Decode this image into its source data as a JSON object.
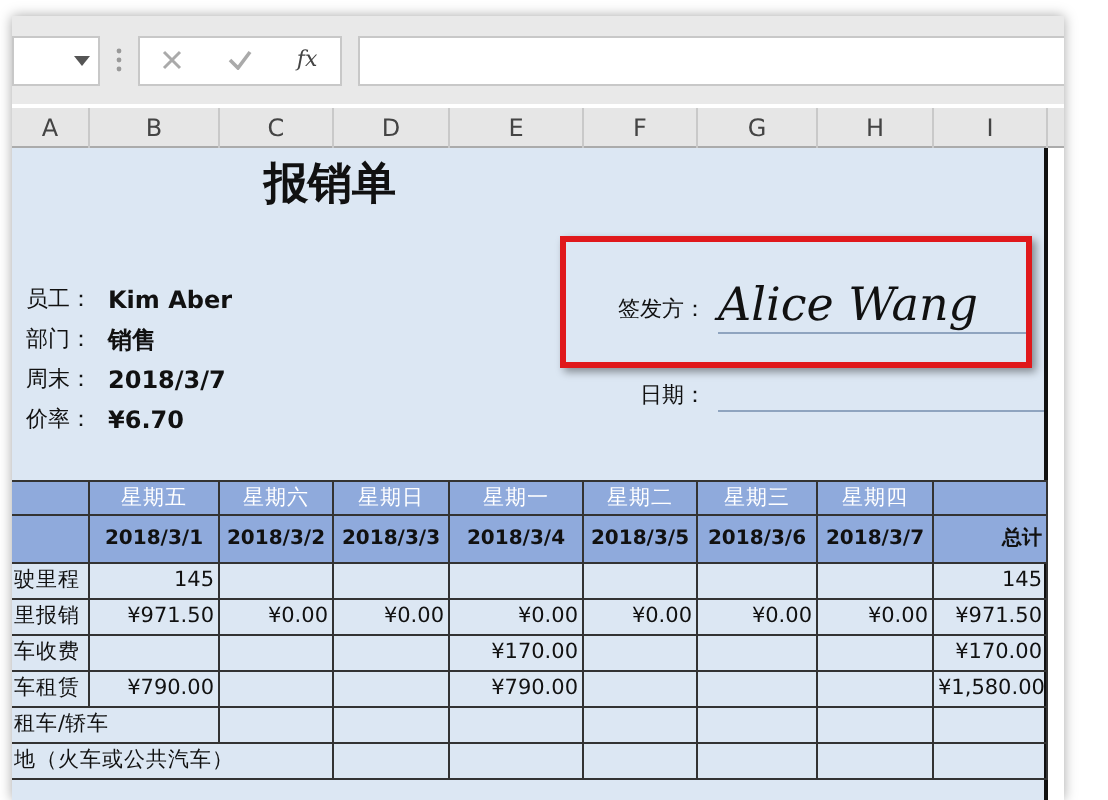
{
  "formula_bar": {
    "function_label": "fx"
  },
  "column_headers": [
    "A",
    "B",
    "C",
    "D",
    "E",
    "F",
    "G",
    "H",
    "I"
  ],
  "title": "报销单",
  "info_fields": [
    {
      "label": "员工：",
      "value": "Kim Aber"
    },
    {
      "label": "部门：",
      "value": "销售"
    },
    {
      "label": "周末：",
      "value": "2018/3/7"
    },
    {
      "label": "价率：",
      "value": "¥6.70"
    }
  ],
  "signature": {
    "label": "签发方：",
    "value": "Alice Wang"
  },
  "date_field": {
    "label": "日期："
  },
  "table": {
    "days": [
      "星期五",
      "星期六",
      "星期日",
      "星期一",
      "星期二",
      "星期三",
      "星期四"
    ],
    "dates": [
      "2018/3/1",
      "2018/3/2",
      "2018/3/3",
      "2018/3/4",
      "2018/3/5",
      "2018/3/6",
      "2018/3/7"
    ],
    "total_label": "总计",
    "rows": [
      {
        "label": "驶里程",
        "cells": [
          "145",
          "",
          "",
          "",
          "",
          "",
          ""
        ],
        "total": "145"
      },
      {
        "label": "里报销",
        "cells": [
          "¥971.50",
          "¥0.00",
          "¥0.00",
          "¥0.00",
          "¥0.00",
          "¥0.00",
          "¥0.00"
        ],
        "total": "¥971.50"
      },
      {
        "label": "车收费",
        "cells": [
          "",
          "",
          "",
          "¥170.00",
          "",
          "",
          ""
        ],
        "total": "¥170.00"
      },
      {
        "label": "车租赁",
        "cells": [
          "¥790.00",
          "",
          "",
          "¥790.00",
          "",
          "",
          ""
        ],
        "total": "¥1,580.00"
      },
      {
        "label": "租车/轿车",
        "cells": [
          "",
          "",
          "",
          "",
          "",
          "",
          ""
        ],
        "total": ""
      },
      {
        "label": "地（火车或公共汽车）",
        "cells": [
          "",
          "",
          "",
          "",
          "",
          "",
          ""
        ],
        "total": ""
      }
    ]
  }
}
